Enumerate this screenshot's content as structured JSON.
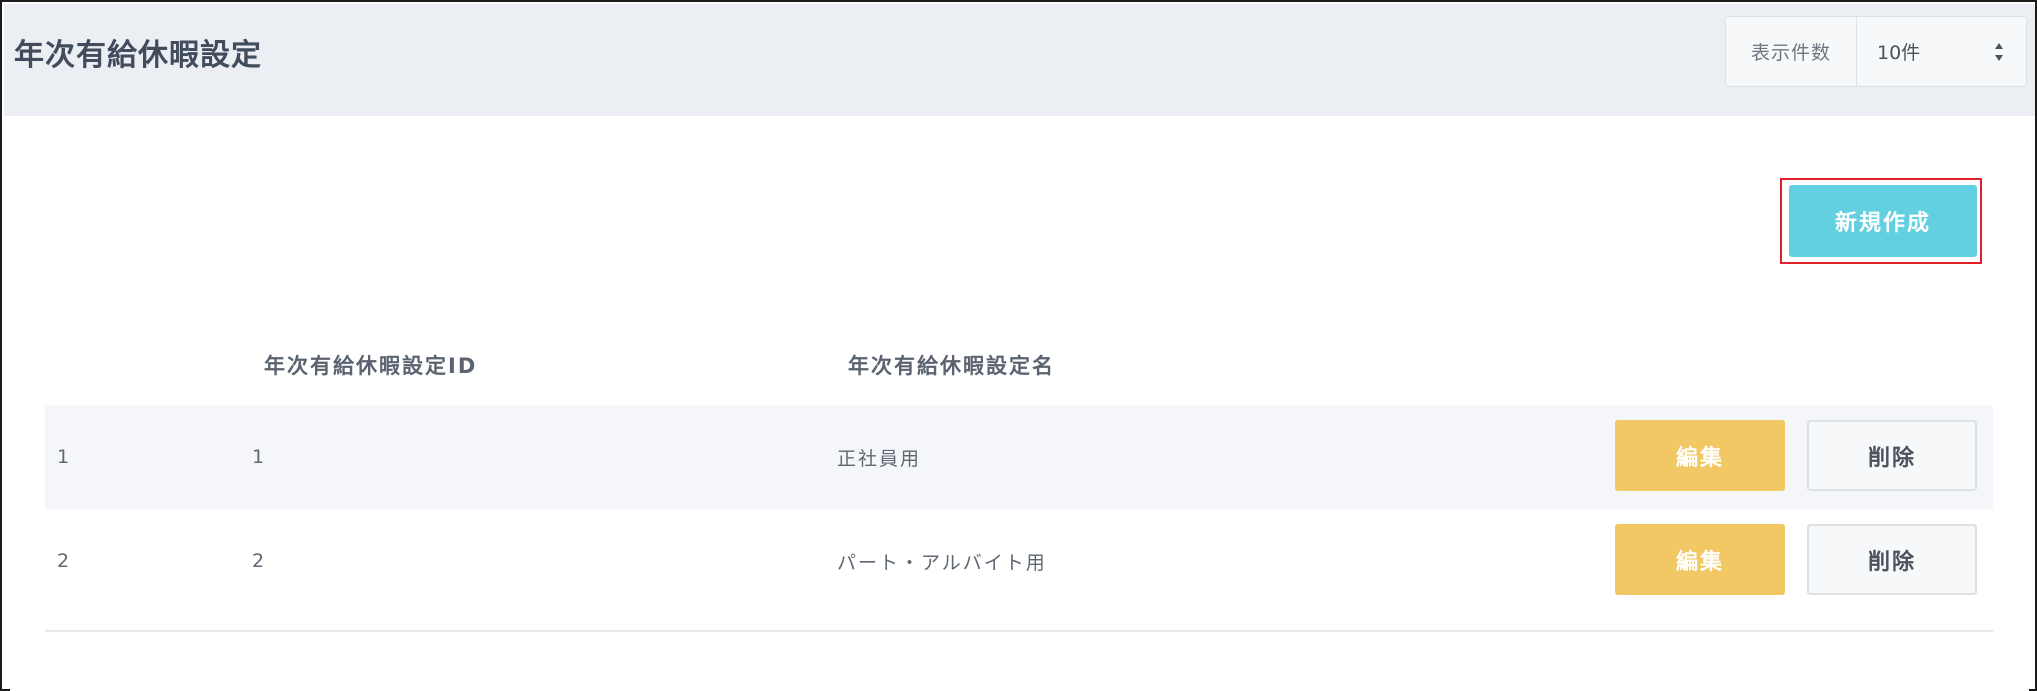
{
  "header": {
    "title": "年次有給休暇設定",
    "per_page_label": "表示件数",
    "per_page_value": "10件",
    "per_page_icon": "sort-arrows-icon"
  },
  "toolbar": {
    "new_label": "新規作成"
  },
  "table": {
    "columns": [
      "",
      "年次有給休暇設定ID",
      "年次有給休暇設定名"
    ],
    "rows": [
      {
        "index": "1",
        "id": "1",
        "name": "正社員用",
        "edit_label": "編集",
        "delete_label": "削除"
      },
      {
        "index": "2",
        "id": "2",
        "name": "パート・アルバイト用",
        "edit_label": "編集",
        "delete_label": "削除"
      }
    ]
  },
  "colors": {
    "primary": "#62d0e0",
    "edit": "#f2c865",
    "highlight": "#e0202a"
  }
}
